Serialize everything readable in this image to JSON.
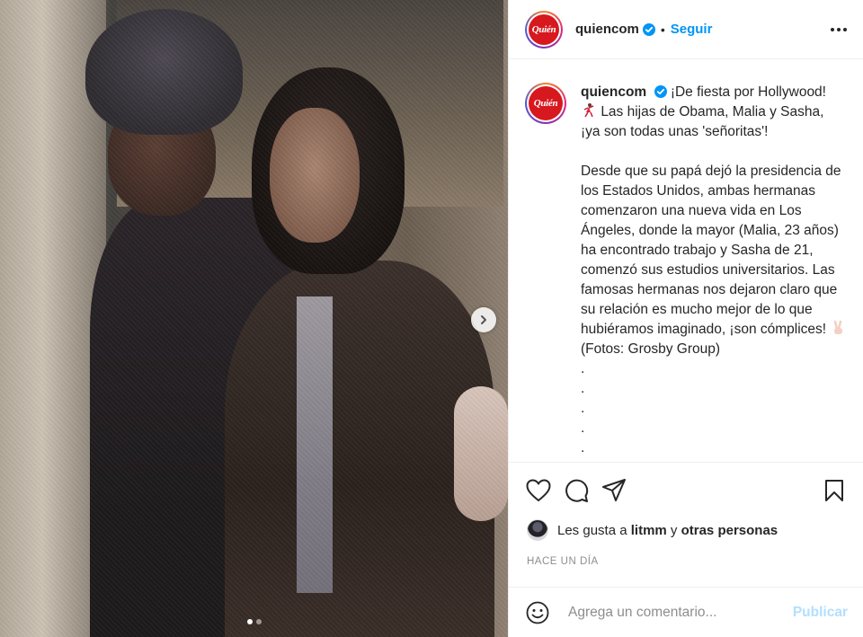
{
  "post": {
    "images_total": 2,
    "current_image": 1
  },
  "header": {
    "avatar_text": "Quién",
    "username": "quiencom",
    "separator": "•",
    "follow_label": "Seguir"
  },
  "caption": {
    "username": "quiencom",
    "line1": "¡De fiesta por Hollywood!",
    "line2": " Las hijas de Obama, Malia y Sasha, ¡ya son todas unas 'señoritas'!",
    "body": "Desde que su papá dejó la presidencia de los Estados Unidos, ambas hermanas comenzaron una nueva vida en Los Ángeles, donde la mayor (Malia, 23 años) ha encontrado trabajo y Sasha de 21, comenzó sus estudios universitarios. Las famosas hermanas nos dejaron claro que su relación es mucho mejor de lo que hubiéramos imaginado, ¡son cómplices!",
    "body_end": " (Fotos: Grosby Group)",
    "dots": ".\n.\n.\n.\n."
  },
  "likes": {
    "prefix": "Les gusta a",
    "user": "litmm",
    "connector": "y",
    "others": "otras personas"
  },
  "timestamp": "HACE UN DÍA",
  "comment": {
    "placeholder": "Agrega un comentario...",
    "publish_label": "Publicar"
  },
  "colors": {
    "accent": "#0095f6",
    "publish_disabled": "#b2dffc",
    "brand_red": "#d7181f"
  }
}
